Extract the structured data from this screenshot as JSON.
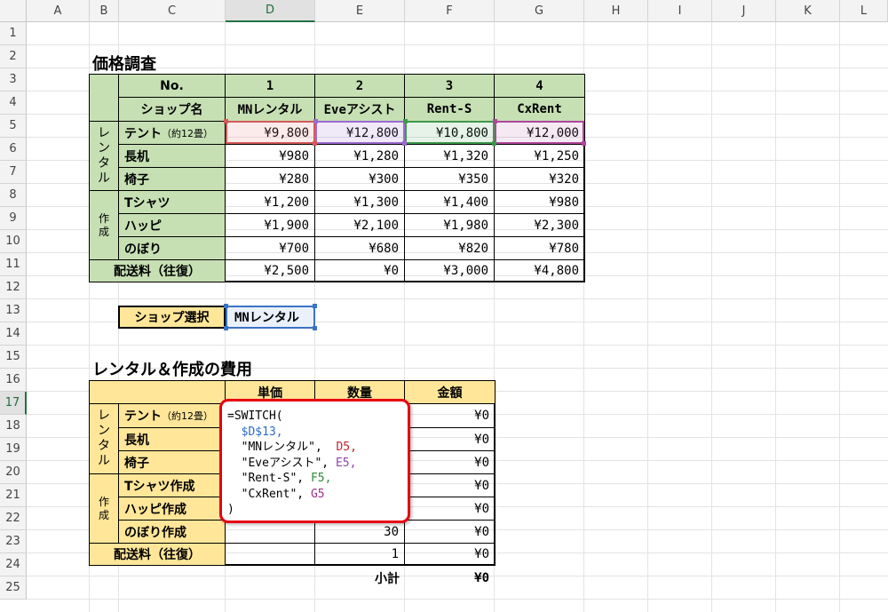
{
  "columns": [
    "A",
    "B",
    "C",
    "D",
    "E",
    "F",
    "G",
    "H",
    "I",
    "J",
    "K",
    "L"
  ],
  "rows": [
    "1",
    "2",
    "3",
    "4",
    "5",
    "6",
    "7",
    "8",
    "9",
    "10",
    "11",
    "12",
    "13",
    "14",
    "15",
    "16",
    "17",
    "18",
    "19",
    "20",
    "21",
    "22",
    "23",
    "24",
    "25"
  ],
  "active_cell": {
    "column": "D",
    "row": "17"
  },
  "price_table": {
    "title": "価格調査",
    "no_label": "No.",
    "shop_label": "ショップ名",
    "numbers": [
      "1",
      "2",
      "3",
      "4"
    ],
    "shops": [
      "MNレンタル",
      "Eveアシスト",
      "Rent-S",
      "CxRent"
    ],
    "rental_group": [
      "レ",
      "ン",
      "タ",
      "ル"
    ],
    "make_group": [
      "作",
      "成"
    ],
    "items": [
      {
        "name": "テント",
        "note": "（約12畳）",
        "prices": [
          "¥9,800",
          "¥12,800",
          "¥10,800",
          "¥12,000"
        ]
      },
      {
        "name": "長机",
        "note": "",
        "prices": [
          "¥980",
          "¥1,280",
          "¥1,320",
          "¥1,250"
        ]
      },
      {
        "name": "椅子",
        "note": "",
        "prices": [
          "¥280",
          "¥300",
          "¥350",
          "¥320"
        ]
      },
      {
        "name": "Tシャツ",
        "note": "",
        "prices": [
          "¥1,200",
          "¥1,300",
          "¥1,400",
          "¥980"
        ]
      },
      {
        "name": "ハッピ",
        "note": "",
        "prices": [
          "¥1,900",
          "¥2,100",
          "¥1,980",
          "¥2,300"
        ]
      },
      {
        "name": "のぼり",
        "note": "",
        "prices": [
          "¥700",
          "¥680",
          "¥820",
          "¥780"
        ]
      }
    ],
    "shipping_label": "配送料（往復）",
    "shipping": [
      "¥2,500",
      "¥0",
      "¥3,000",
      "¥4,800"
    ]
  },
  "shop_select": {
    "label": "ショップ選択",
    "value": "MNレンタル"
  },
  "cost_table": {
    "title": "レンタル＆作成の費用",
    "headers": [
      "単価",
      "数量",
      "金額"
    ],
    "rental_group": [
      "レ",
      "ン",
      "タ",
      "ル"
    ],
    "make_group": [
      "作",
      "成"
    ],
    "items": [
      {
        "name": "テント",
        "note": "（約12畳）",
        "qty": "",
        "amount": "¥0"
      },
      {
        "name": "長机",
        "note": "",
        "qty": "",
        "amount": "¥0"
      },
      {
        "name": "椅子",
        "note": "",
        "qty": "",
        "amount": "¥0"
      },
      {
        "name": "Tシャツ作成",
        "note": "",
        "qty": "",
        "amount": "¥0"
      },
      {
        "name": "ハッピ作成",
        "note": "",
        "qty": "",
        "amount": "¥0"
      },
      {
        "name": "のぼり作成",
        "note": "",
        "qty": "30",
        "amount": "¥0"
      }
    ],
    "shipping_label": "配送料（往復）",
    "shipping_qty": "1",
    "shipping_amount": "¥0",
    "subtotal_label": "小計",
    "subtotal_value": "¥0"
  },
  "formula_popup": {
    "line1": "=SWITCH(",
    "line2": "$D$13,",
    "line3a": "\"MNレンタル\",",
    "line3b": "D5,",
    "line4a": "\"Eveアシスト\",",
    "line4b": "E5,",
    "line5a": "\"Rent-S\",",
    "line5b": "F5,",
    "line6a": "\"CxRent\",",
    "line6b": "G5",
    "line7": ")"
  },
  "colors": {
    "header_green": "#c6e0b4",
    "header_yellow": "#ffe699",
    "highlight_red": "#e60012",
    "ref_blue": "#2e6bc6",
    "ref_red": "#c0262d",
    "ref_purple": "#8e44ad",
    "ref_green": "#2e8b3a",
    "ref_magenta": "#a0308a"
  }
}
